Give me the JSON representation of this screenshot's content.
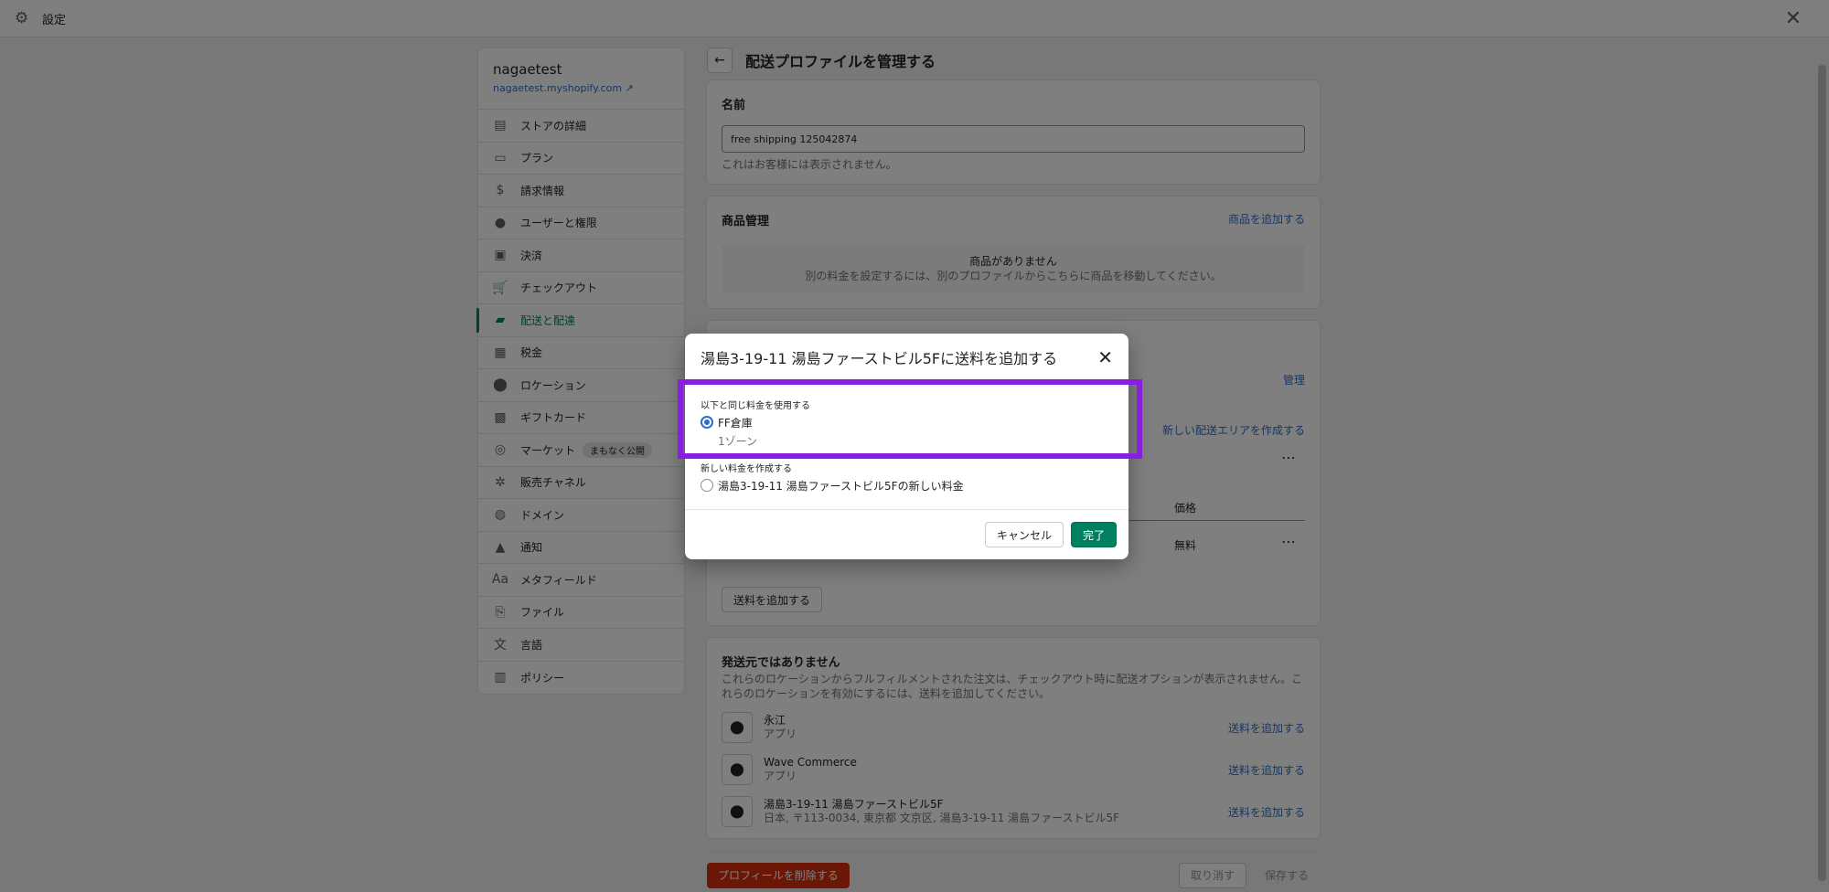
{
  "window": {
    "title": "設定"
  },
  "sidebar": {
    "store_name": "nagaetest",
    "store_url": "nagaetest.myshopify.com",
    "items": [
      {
        "label": "ストアの詳細",
        "icon": "store-icon"
      },
      {
        "label": "プラン",
        "icon": "plan-icon"
      },
      {
        "label": "請求情報",
        "icon": "billing-icon"
      },
      {
        "label": "ユーザーと権限",
        "icon": "user-icon"
      },
      {
        "label": "決済",
        "icon": "payment-icon"
      },
      {
        "label": "チェックアウト",
        "icon": "cart-icon"
      },
      {
        "label": "配送と配達",
        "icon": "truck-icon",
        "active": true
      },
      {
        "label": "税金",
        "icon": "tax-icon"
      },
      {
        "label": "ロケーション",
        "icon": "location-icon"
      },
      {
        "label": "ギフトカード",
        "icon": "gift-icon"
      },
      {
        "label": "マーケット",
        "icon": "globe-icon",
        "badge": "まもなく公開"
      },
      {
        "label": "販売チャネル",
        "icon": "channels-icon"
      },
      {
        "label": "ドメイン",
        "icon": "domain-icon"
      },
      {
        "label": "通知",
        "icon": "bell-icon"
      },
      {
        "label": "メタフィールド",
        "icon": "metafield-icon"
      },
      {
        "label": "ファイル",
        "icon": "file-icon"
      },
      {
        "label": "言語",
        "icon": "language-icon"
      },
      {
        "label": "ポリシー",
        "icon": "policy-icon"
      }
    ]
  },
  "main": {
    "title": "配送プロファイルを管理する",
    "name_card": {
      "heading": "名前",
      "value": "free shipping 125042874",
      "help": "これはお客様には表示されません。"
    },
    "products_card": {
      "heading": "商品管理",
      "add_link": "商品を追加する",
      "empty_title": "商品がありません",
      "empty_sub": "別の料金を設定するには、別のプロファイルからこちらに商品を移動してください。"
    },
    "zones_card": {
      "manage_link": "管理",
      "create_zone_link": "新しい配送エリアを作成する",
      "price_header": "価格",
      "price_value": "無料",
      "add_rate_button": "送料を追加する"
    },
    "no_origin_card": {
      "heading": "発送元ではありません",
      "desc": "これらのロケーションからフルフィルメントされた注文は、チェックアウト時に配送オプションが表示されません。これらのロケーションを有効にするには、送料を追加してください。",
      "locations": [
        {
          "name": "永江",
          "sub": "アプリ",
          "action": "送料を追加する"
        },
        {
          "name": "Wave Commerce",
          "sub": "アプリ",
          "action": "送料を追加する"
        },
        {
          "name": "湯島3-19-11 湯島ファーストビル5F",
          "sub": "日本, 〒113-0034, 東京都 文京区, 湯島3-19-11 湯島ファーストビル5F",
          "action": "送料を追加する"
        }
      ]
    },
    "footer": {
      "delete_button": "プロフィールを削除する",
      "cancel_button": "取り消す",
      "save_button": "保存する"
    }
  },
  "modal": {
    "title": "湯島3-19-11 湯島ファーストビル5Fに送料を追加する",
    "same_rate_label": "以下と同じ料金を使用する",
    "same_rate_option": "FF倉庫",
    "same_rate_zone": "1ゾーン",
    "new_rate_label": "新しい料金を作成する",
    "new_rate_option": "湯島3-19-11 湯島ファーストビル5Fの新しい料金",
    "cancel_button": "キャンセル",
    "done_button": "完了"
  },
  "colors": {
    "accent": "#008060",
    "link": "#2c6ecb",
    "highlight": "#8a1ee0",
    "danger": "#d82c0d"
  }
}
